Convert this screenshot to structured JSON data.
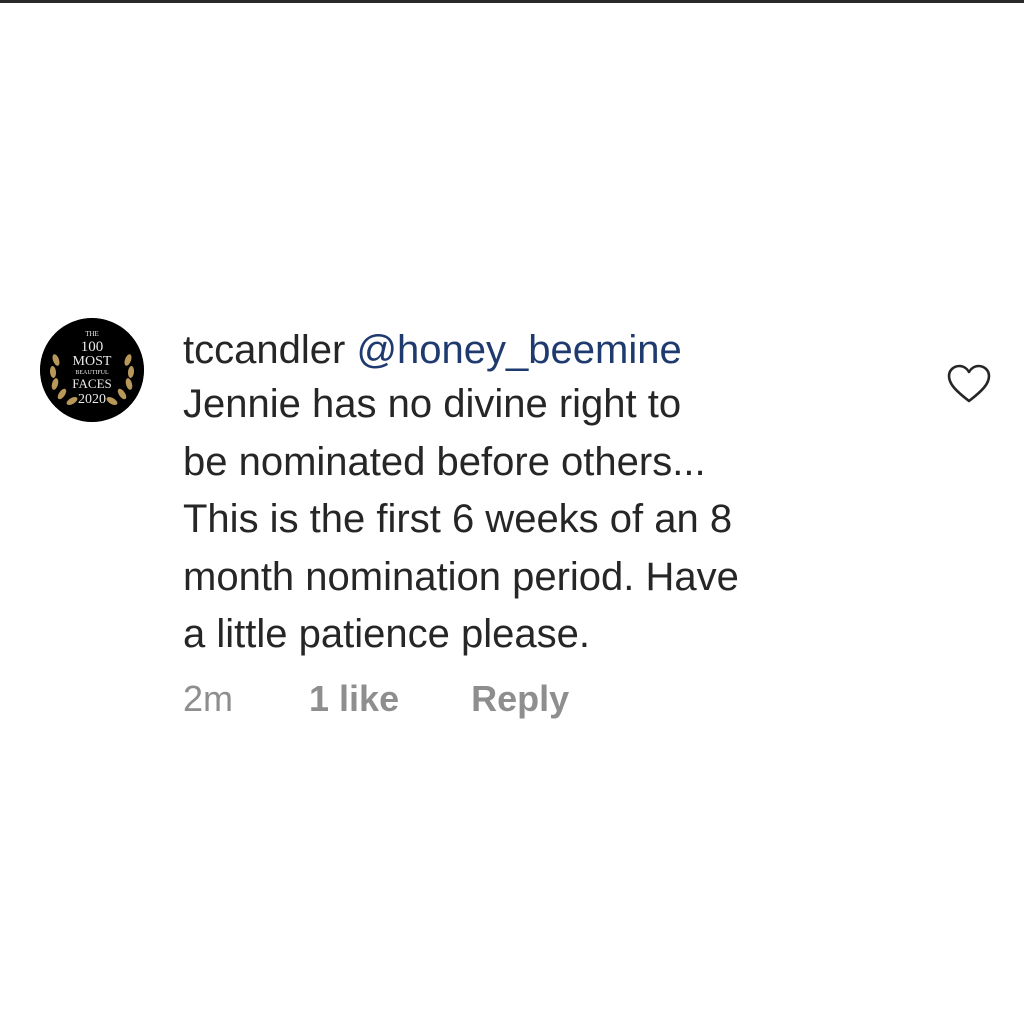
{
  "comment": {
    "avatar": {
      "icon": "award-badge-icon",
      "badge_lines": [
        "THE",
        "100",
        "MOST",
        "BEAUTIFUL",
        "FACES",
        "2020"
      ],
      "colors": {
        "background": "#000000",
        "text": "#e9e9e9",
        "laurel": "#b8975a"
      }
    },
    "username": "tccandler",
    "mention": "@honey_beemine",
    "body_lines": [
      "Jennie has no divine right to",
      "be nominated before others...",
      "This is the first 6 weeks of an 8",
      "month nomination period.  Have",
      "a little patience please."
    ],
    "meta": {
      "time": "2m",
      "likes": "1 like",
      "reply": "Reply"
    },
    "like_icon": "heart-outline-icon"
  }
}
